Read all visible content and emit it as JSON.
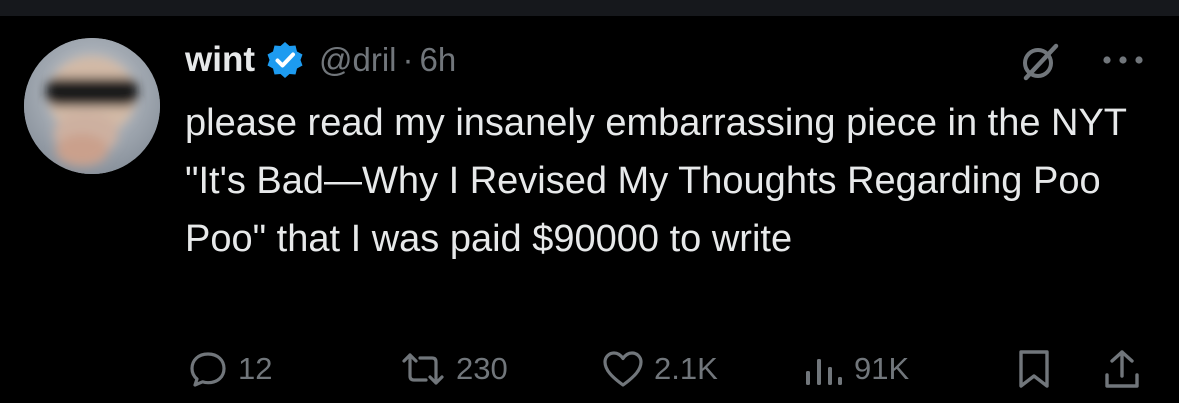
{
  "tweet": {
    "author_name": "wint",
    "handle": "@dril",
    "separator": "·",
    "time": "6h",
    "text": "please read my insanely embarrassing piece in the NYT \"It's Bad—Why I Revised My Thoughts Regarding Poo Poo\" that I was paid $90000 to write"
  },
  "actions": {
    "replies": "12",
    "reposts": "230",
    "likes": "2.1K",
    "views": "91K"
  },
  "icons": {
    "verified": "verified-badge-icon",
    "grok": "grok-icon",
    "more": "more-icon",
    "reply": "reply-icon",
    "repost": "repost-icon",
    "like": "heart-icon",
    "views": "views-icon",
    "bookmark": "bookmark-icon",
    "share": "share-icon"
  },
  "colors": {
    "background": "#000000",
    "text": "#e7e9ea",
    "secondary": "#71767b",
    "verified_blue": "#1d9bf0"
  }
}
